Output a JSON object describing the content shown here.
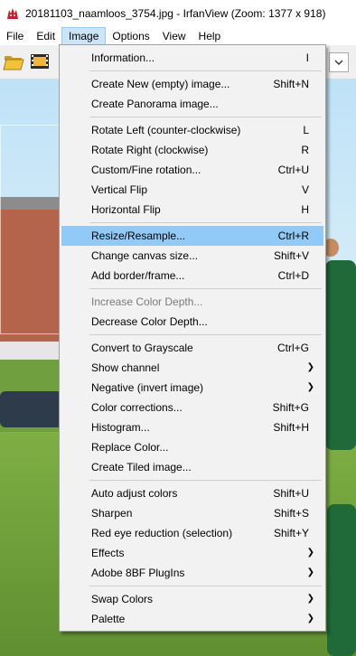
{
  "window": {
    "title": "20181103_naamloos_3754.jpg - IrfanView (Zoom: 1377 x 918)",
    "app_icon": "irfanview-cat-icon"
  },
  "menubar": {
    "items": [
      {
        "label": "File"
      },
      {
        "label": "Edit"
      },
      {
        "label": "Image",
        "active": true
      },
      {
        "label": "Options"
      },
      {
        "label": "View"
      },
      {
        "label": "Help"
      }
    ]
  },
  "toolbar": {
    "open_icon": "folder-open-icon",
    "slideshow_icon": "filmstrip-icon",
    "combo_icon": "chevron-down-icon"
  },
  "image_menu": {
    "highlight_color": "#91c9f7",
    "items": [
      {
        "label": "Information...",
        "shortcut": "I"
      },
      {
        "sep": true
      },
      {
        "label": "Create New (empty) image...",
        "shortcut": "Shift+N"
      },
      {
        "label": "Create Panorama image...",
        "shortcut": ""
      },
      {
        "sep": true
      },
      {
        "label": "Rotate Left (counter-clockwise)",
        "shortcut": "L"
      },
      {
        "label": "Rotate Right (clockwise)",
        "shortcut": "R"
      },
      {
        "label": "Custom/Fine rotation...",
        "shortcut": "Ctrl+U"
      },
      {
        "label": "Vertical Flip",
        "shortcut": "V"
      },
      {
        "label": "Horizontal Flip",
        "shortcut": "H"
      },
      {
        "sep": true
      },
      {
        "label": "Resize/Resample...",
        "shortcut": "Ctrl+R",
        "highlight": true
      },
      {
        "label": "Change canvas size...",
        "shortcut": "Shift+V"
      },
      {
        "label": "Add border/frame...",
        "shortcut": "Ctrl+D"
      },
      {
        "sep": true
      },
      {
        "label": "Increase Color Depth...",
        "shortcut": "",
        "disabled": true
      },
      {
        "label": "Decrease Color Depth...",
        "shortcut": ""
      },
      {
        "sep": true
      },
      {
        "label": "Convert to Grayscale",
        "shortcut": "Ctrl+G"
      },
      {
        "label": "Show channel",
        "shortcut": "",
        "submenu": true
      },
      {
        "label": "Negative (invert image)",
        "shortcut": "",
        "submenu": true
      },
      {
        "label": "Color corrections...",
        "shortcut": "Shift+G"
      },
      {
        "label": "Histogram...",
        "shortcut": "Shift+H"
      },
      {
        "label": "Replace Color...",
        "shortcut": ""
      },
      {
        "label": "Create Tiled image...",
        "shortcut": ""
      },
      {
        "sep": true
      },
      {
        "label": "Auto adjust colors",
        "shortcut": "Shift+U"
      },
      {
        "label": "Sharpen",
        "shortcut": "Shift+S"
      },
      {
        "label": "Red eye reduction (selection)",
        "shortcut": "Shift+Y"
      },
      {
        "label": "Effects",
        "shortcut": "",
        "submenu": true
      },
      {
        "label": "Adobe 8BF PlugIns",
        "shortcut": "",
        "submenu": true
      },
      {
        "sep": true
      },
      {
        "label": "Swap Colors",
        "shortcut": "",
        "submenu": true
      },
      {
        "label": "Palette",
        "shortcut": "",
        "submenu": true
      }
    ]
  }
}
